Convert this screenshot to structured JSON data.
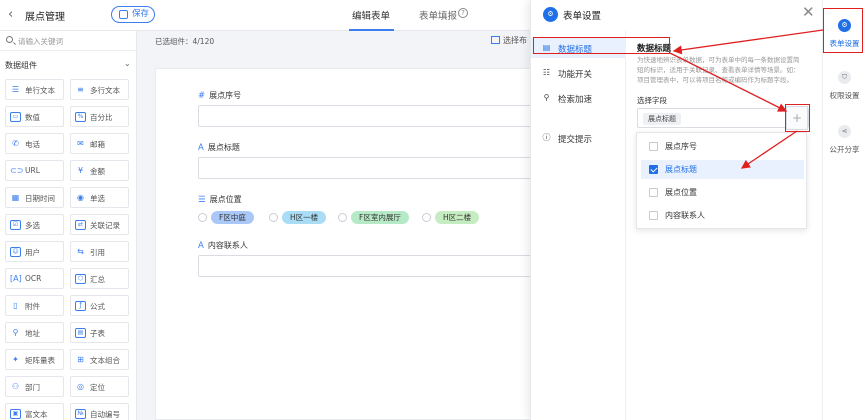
{
  "app": {
    "back_icon": "back-chevron-icon",
    "title": "展点管理",
    "save_label": "保存"
  },
  "tabs": [
    {
      "label": "编辑表单",
      "active": true
    },
    {
      "label": "表单填报",
      "active": false
    }
  ],
  "sidebar": {
    "search_placeholder": "请输入关键词",
    "group_title": "数据组件",
    "components": [
      {
        "label": "单行文本",
        "icon": "single-line-text-icon"
      },
      {
        "label": "多行文本",
        "icon": "multi-line-text-icon"
      },
      {
        "label": "数值",
        "icon": "number-icon"
      },
      {
        "label": "百分比",
        "icon": "percent-icon"
      },
      {
        "label": "电话",
        "icon": "phone-icon"
      },
      {
        "label": "邮箱",
        "icon": "email-icon"
      },
      {
        "label": "URL",
        "icon": "link-icon"
      },
      {
        "label": "金额",
        "icon": "money-icon"
      },
      {
        "label": "日期时间",
        "icon": "calendar-icon"
      },
      {
        "label": "单选",
        "icon": "radio-icon"
      },
      {
        "label": "多选",
        "icon": "checkbox-icon"
      },
      {
        "label": "关联记录",
        "icon": "relation-icon"
      },
      {
        "label": "用户",
        "icon": "user-icon"
      },
      {
        "label": "引用",
        "icon": "reference-icon"
      },
      {
        "label": "OCR",
        "icon": "ocr-icon"
      },
      {
        "label": "汇总",
        "icon": "summary-icon"
      },
      {
        "label": "附件",
        "icon": "attachment-icon"
      },
      {
        "label": "公式",
        "icon": "formula-icon"
      },
      {
        "label": "地址",
        "icon": "location-icon"
      },
      {
        "label": "子表",
        "icon": "subtable-icon"
      },
      {
        "label": "矩阵量表",
        "icon": "matrix-icon"
      },
      {
        "label": "文本组合",
        "icon": "text-combine-icon"
      },
      {
        "label": "部门",
        "icon": "department-icon"
      },
      {
        "label": "定位",
        "icon": "geolocation-icon"
      },
      {
        "label": "富文本",
        "icon": "rich-text-icon"
      },
      {
        "label": "自动编号",
        "icon": "auto-number-icon"
      }
    ]
  },
  "canvas": {
    "selected_count": "已选组件：4/120",
    "layout_label": "选择布",
    "fields": [
      {
        "label": "展点序号",
        "icon": "#"
      },
      {
        "label": "展点标题",
        "icon": "A"
      },
      {
        "label": "展点位置",
        "icon": "☰",
        "options": [
          {
            "label": "F区中庭",
            "color": "#a9c8f8"
          },
          {
            "label": "H区一楼",
            "color": "#a9ddf6"
          },
          {
            "label": "F区室内展厅",
            "color": "#b6e9c6"
          },
          {
            "label": "H区二楼",
            "color": "#c6ecc1"
          }
        ]
      },
      {
        "label": "内容联系人",
        "icon": "A"
      }
    ]
  },
  "drawer": {
    "title": "表单设置",
    "nav": [
      {
        "label": "数据标题",
        "icon": "data-title-icon",
        "active": true
      },
      {
        "label": "功能开关",
        "icon": "feature-switch-icon",
        "active": false
      },
      {
        "label": "检索加速",
        "icon": "search-accelerate-icon",
        "active": false
      },
      {
        "label": "提交提示",
        "icon": "submit-tip-icon",
        "active": false
      }
    ],
    "section_title": "数据标题",
    "description": "为快速地辨识表单数据，可为表单中的每一条数据设置简短的标识，适用于关联记录、查看表单详情等场景。如：项目管理表中，可以将项目名称或编码作为标题字段。",
    "choose_label": "选择字段",
    "selected_tag": "展点标题",
    "plus_label": "+",
    "options": [
      {
        "label": "展点序号",
        "checked": false
      },
      {
        "label": "展点标题",
        "checked": true
      },
      {
        "label": "展点位置",
        "checked": false
      },
      {
        "label": "内容联系人",
        "checked": false
      }
    ]
  },
  "rightbar": [
    {
      "label": "表单设置",
      "icon": "form-settings-icon",
      "active": true
    },
    {
      "label": "权限设置",
      "icon": "permission-icon",
      "active": false
    },
    {
      "label": "公开分享",
      "icon": "share-icon",
      "active": false
    }
  ],
  "colors": {
    "accent": "#1f6fe8",
    "annotation": "#e02020"
  }
}
